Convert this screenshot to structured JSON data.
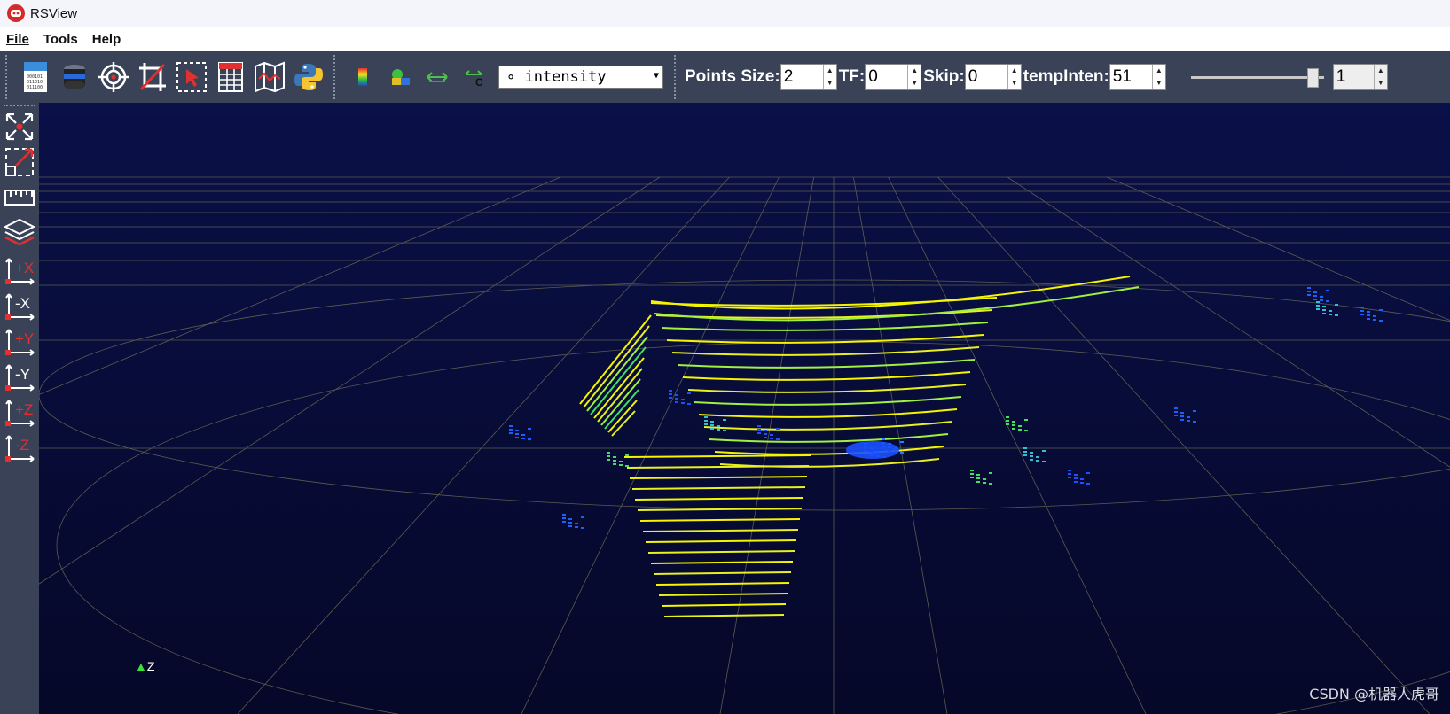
{
  "window": {
    "title": "RSView"
  },
  "menu": {
    "items": [
      "File",
      "Tools",
      "Help"
    ]
  },
  "toolbar": {
    "icons": [
      "open-file-icon",
      "sensor-icon",
      "target-icon",
      "crop-icon",
      "select-region-icon",
      "spreadsheet-icon",
      "map-icon",
      "python-icon"
    ],
    "color_icons": [
      "color-legend-icon",
      "color-by-icon",
      "measure-icon",
      "calibrate-icon"
    ],
    "color_by": {
      "value": "∘ intensity"
    },
    "points_size": {
      "label": "Points Size:",
      "value": "2"
    },
    "tf": {
      "label": "TF:",
      "value": "0"
    },
    "skip": {
      "label": "Skip:",
      "value": "0"
    },
    "temp_inten": {
      "label": "tempInten:",
      "value": "51"
    },
    "slider": {
      "value": 1.0
    },
    "frame": {
      "value": "1"
    }
  },
  "sidebar": {
    "buttons": [
      "reset-camera-icon",
      "zoom-box-icon",
      "ruler-icon",
      "layers-icon",
      "view-plus-x",
      "view-minus-x",
      "view-plus-y",
      "view-minus-y",
      "view-plus-z",
      "view-minus-z"
    ],
    "view_labels": [
      "+X",
      "-X",
      "+Y",
      "-Y",
      "+Z",
      "-Z"
    ]
  },
  "viewport": {
    "background": "#050a3a",
    "axis_label": "Z",
    "watermark": "CSDN @机器人虎哥"
  },
  "colors": {
    "toolbar": "#3a4257",
    "accent_red": "#e03030",
    "scan_yellow": "#f5f500",
    "scan_green": "#40e040",
    "scan_blue": "#1a50ff"
  }
}
